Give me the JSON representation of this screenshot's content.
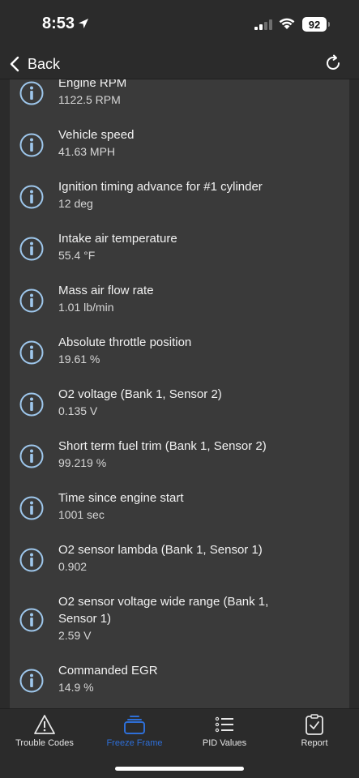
{
  "status_bar": {
    "time": "8:53",
    "battery": "92"
  },
  "nav": {
    "back_label": "Back"
  },
  "pids": [
    {
      "name": "Engine RPM",
      "value": "1122.5 RPM"
    },
    {
      "name": "Vehicle speed",
      "value": "41.63 MPH"
    },
    {
      "name": "Ignition timing advance for #1 cylinder",
      "value": "12 deg"
    },
    {
      "name": "Intake air temperature",
      "value": "55.4 °F"
    },
    {
      "name": "Mass air flow rate",
      "value": "1.01 lb/min"
    },
    {
      "name": "Absolute throttle position",
      "value": "19.61 %"
    },
    {
      "name": "O2 voltage (Bank 1, Sensor 2)",
      "value": "0.135 V"
    },
    {
      "name": "Short term fuel trim (Bank 1, Sensor 2)",
      "value": "99.219 %"
    },
    {
      "name": "Time since engine start",
      "value": "1001 sec"
    },
    {
      "name": "O2 sensor lambda (Bank 1, Sensor 1)",
      "value": "0.902"
    },
    {
      "name": "O2 sensor voltage wide range (Bank 1, Sensor 1)",
      "value": "2.59 V"
    },
    {
      "name": "Commanded EGR",
      "value": "14.9 %"
    }
  ],
  "tabs": [
    {
      "label": "Trouble Codes",
      "icon": "warning-triangle-icon"
    },
    {
      "label": "Freeze Frame",
      "icon": "stack-icon",
      "active": true
    },
    {
      "label": "PID Values",
      "icon": "list-icon"
    },
    {
      "label": "Report",
      "icon": "clipboard-check-icon"
    }
  ],
  "colors": {
    "accent": "#2e6fd8",
    "background": "#2b2b2b",
    "card": "#3a3a3a",
    "info_icon": "#9ec7ec"
  }
}
